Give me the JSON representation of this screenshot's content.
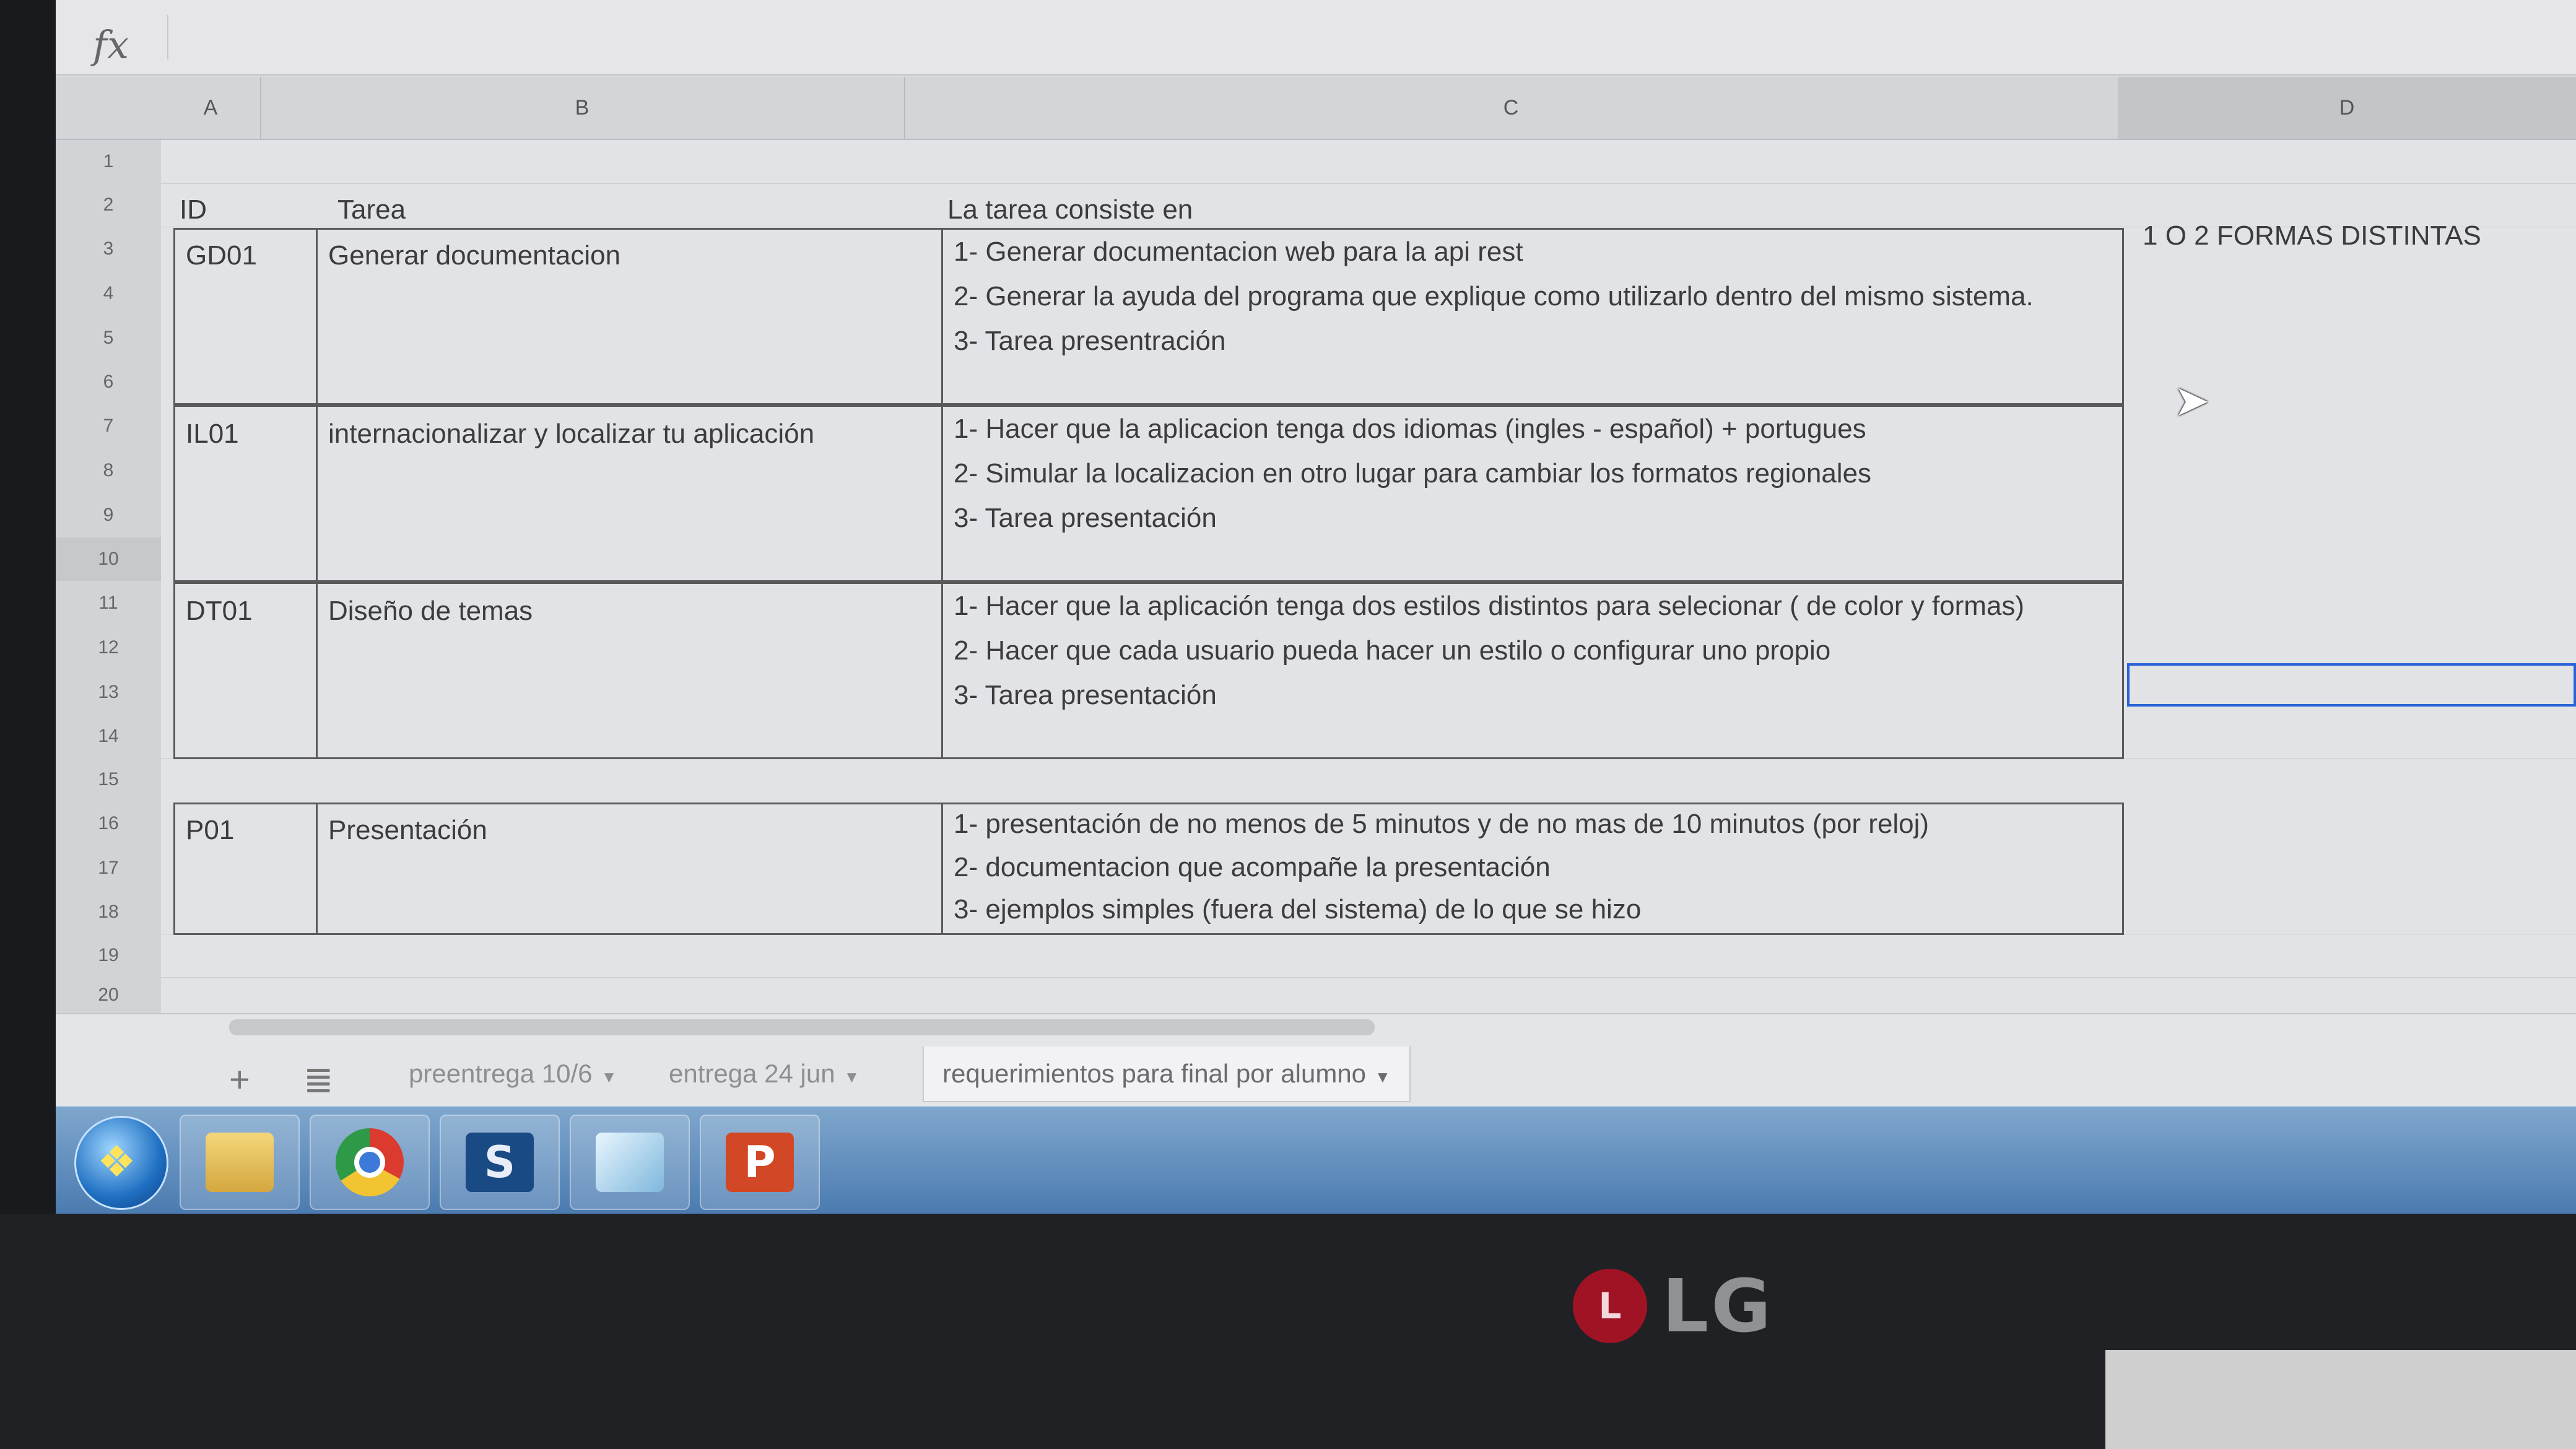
{
  "formula_bar": {
    "fx_label": "fx",
    "value": ""
  },
  "columns": [
    "A",
    "B",
    "C",
    "D"
  ],
  "rows": [
    "1",
    "2",
    "3",
    "4",
    "5",
    "6",
    "7",
    "8",
    "9",
    "10",
    "11",
    "12",
    "13",
    "14",
    "15",
    "16",
    "17",
    "18",
    "19",
    "20"
  ],
  "header_row": {
    "id": "ID",
    "task": "Tarea",
    "description": "La tarea consiste en"
  },
  "tasks": [
    {
      "id": "GD01",
      "name": "Generar documentacion",
      "steps": [
        "1- Generar documentacion web para la api rest",
        "2- Generar la ayuda del programa que explique como utilizarlo dentro del mismo sistema.",
        "3- Tarea presentración"
      ],
      "note": "1 O 2 FORMAS DISTINTAS"
    },
    {
      "id": "IL01",
      "name": "internacionalizar y localizar tu aplicación",
      "steps": [
        "1- Hacer que la aplicacion tenga dos idiomas (ingles - español) + portugues",
        "2- Simular  la localizacion en otro lugar para cambiar los formatos regionales",
        "3- Tarea presentación"
      ]
    },
    {
      "id": "DT01",
      "name": "Diseño de temas",
      "steps": [
        "1- Hacer que la aplicación tenga dos estilos distintos para selecionar ( de color y formas)",
        "2- Hacer que cada usuario pueda hacer un estilo o configurar uno propio",
        "3- Tarea presentación"
      ]
    },
    {
      "id": "P01",
      "name": "Presentación",
      "steps": [
        "1- presentación de no menos de 5 minutos y de no mas de 10 minutos (por reloj)",
        "2- documentacion que acompañe la presentación",
        "3- ejemplos simples (fuera del sistema) de lo que se hizo"
      ]
    }
  ],
  "sheet_tabs": [
    {
      "label": "preentrega 10/6",
      "active": false
    },
    {
      "label": "entrega 24 jun",
      "active": false
    },
    {
      "label": "requerimientos para final por alumno",
      "active": true
    }
  ],
  "tab_controls": {
    "add": "+",
    "list": "≣"
  },
  "taskbar": {
    "apps": [
      "start-icon",
      "folder-icon",
      "chrome-icon",
      "s-app-icon",
      "notes-icon",
      "powerpoint-icon"
    ]
  },
  "monitor": {
    "brand": "LG"
  }
}
